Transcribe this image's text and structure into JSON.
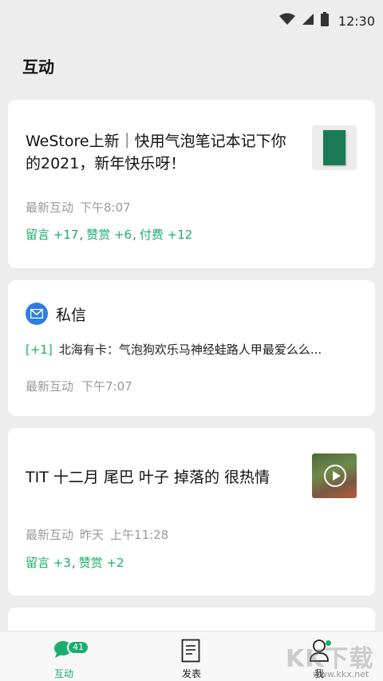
{
  "status_bar": {
    "time": "12:30",
    "icons": [
      "wifi-icon",
      "signal-icon",
      "battery-icon"
    ]
  },
  "page": {
    "title": "互动"
  },
  "cards": [
    {
      "title": "WeStore上新｜快用气泡笔记本记下你的2021，新年快乐呀！",
      "meta_label": "最新互动",
      "meta_time": "下午8:07",
      "stats": {
        "comments": "留言 +17",
        "rewards": "赞赏 +6",
        "paid": "付费 +12"
      },
      "thumbnail": "green-notebook-thumbnail"
    },
    {
      "title": "TIT 十二月 尾巴 叶子 掉落的 很热情",
      "meta_label": "最新互动",
      "meta_day": "昨天",
      "meta_time": "上午11:28",
      "stats": {
        "comments": "留言 +3",
        "rewards": "赞赏 +2"
      },
      "thumbnail": "video-thumbnail"
    }
  ],
  "private_message": {
    "title": "私信",
    "count": "[+1]",
    "preview": "北海有卡：气泡狗欢乐马神经蛙路人甲最爱么么...",
    "meta_label": "最新互动",
    "meta_time": "下午7:07"
  },
  "tabbar": {
    "tabs": [
      {
        "label": "互动",
        "badge": "41",
        "icon": "chat-bubbles-icon",
        "active": true
      },
      {
        "label": "发表",
        "icon": "document-icon"
      },
      {
        "label": "我",
        "icon": "person-icon"
      }
    ]
  },
  "watermark": {
    "text": "KK下载",
    "url": "www.kkx.net"
  },
  "colors": {
    "accent": "#1aad6f",
    "mail": "#2f7de1",
    "background": "#ededed"
  }
}
